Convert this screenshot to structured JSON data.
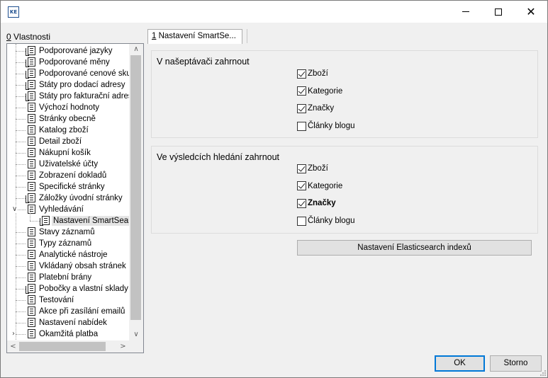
{
  "window": {
    "app_icon_text": "KE",
    "minimize_icon": "minimize-icon",
    "maximize_icon": "maximize-icon",
    "close_icon": "close-icon",
    "close_glyph": "✕"
  },
  "left_panel": {
    "label_key": "0",
    "label_rest": " Vlastnosti"
  },
  "tree": {
    "items": [
      {
        "label": "Podporované jazyky",
        "icon": "multi-doc-icon",
        "level": 1
      },
      {
        "label": "Podporované měny",
        "icon": "multi-doc-icon",
        "level": 1
      },
      {
        "label": "Podporované cenové skupiny",
        "icon": "multi-doc-icon",
        "level": 1
      },
      {
        "label": "Státy pro dodací adresy",
        "icon": "multi-doc-icon",
        "level": 1
      },
      {
        "label": "Státy pro fakturační adresy",
        "icon": "multi-doc-icon",
        "level": 1
      },
      {
        "label": "Výchozí hodnoty",
        "icon": "doc-icon",
        "level": 1
      },
      {
        "label": "Stránky obecně",
        "icon": "doc-icon",
        "level": 1
      },
      {
        "label": "Katalog zboží",
        "icon": "doc-icon",
        "level": 1
      },
      {
        "label": "Detail zboží",
        "icon": "doc-icon",
        "level": 1
      },
      {
        "label": "Nákupní košík",
        "icon": "doc-icon",
        "level": 1
      },
      {
        "label": "Uživatelské účty",
        "icon": "doc-icon",
        "level": 1
      },
      {
        "label": "Zobrazení dokladů",
        "icon": "doc-icon",
        "level": 1
      },
      {
        "label": "Specifické stránky",
        "icon": "doc-icon",
        "level": 1
      },
      {
        "label": "Záložky úvodní stránky",
        "icon": "multi-doc-icon",
        "level": 1
      },
      {
        "label": "Vyhledávání",
        "icon": "doc-icon",
        "level": 1,
        "expanded": true
      },
      {
        "label": "Nastavení SmartSearch",
        "icon": "multi-doc-icon",
        "level": 2,
        "selected": true
      },
      {
        "label": "Stavy záznamů",
        "icon": "doc-icon",
        "level": 1
      },
      {
        "label": "Typy záznamů",
        "icon": "doc-icon",
        "level": 1
      },
      {
        "label": "Analytické nástroje",
        "icon": "doc-icon",
        "level": 1
      },
      {
        "label": "Vkládaný obsah stránek",
        "icon": "doc-icon",
        "level": 1
      },
      {
        "label": "Platební brány",
        "icon": "doc-icon",
        "level": 1
      },
      {
        "label": "Pobočky a vlastní sklady",
        "icon": "multi-doc-icon",
        "level": 1
      },
      {
        "label": "Testování",
        "icon": "doc-icon",
        "level": 1
      },
      {
        "label": "Akce při zasílání emailů",
        "icon": "doc-icon",
        "level": 1
      },
      {
        "label": "Nastavení nabídek",
        "icon": "doc-icon",
        "level": 1
      },
      {
        "label": "Okamžitá platba",
        "icon": "doc-icon",
        "level": 1,
        "collapsed": true
      }
    ],
    "expand_glyph": "∨",
    "collapse_glyph": "›",
    "scroll_up": "∧",
    "scroll_down": "∨",
    "scroll_left": "<",
    "scroll_right": ">"
  },
  "tab": {
    "key": "1",
    "label_rest": " Nastavení SmartSe..."
  },
  "group1": {
    "title": "V našeptávači zahrnout",
    "options": [
      {
        "label": "Zboží",
        "checked": true,
        "bold": false
      },
      {
        "label": "Kategorie",
        "checked": true,
        "bold": false
      },
      {
        "label": "Značky",
        "checked": true,
        "bold": false
      },
      {
        "label": "Články blogu",
        "checked": false,
        "bold": false
      }
    ]
  },
  "group2": {
    "title": "Ve výsledcích hledání zahrnout",
    "options": [
      {
        "label": "Zboží",
        "checked": true,
        "bold": false
      },
      {
        "label": "Kategorie",
        "checked": true,
        "bold": false
      },
      {
        "label": "Značky",
        "checked": true,
        "bold": true
      },
      {
        "label": "Články blogu",
        "checked": false,
        "bold": false
      }
    ]
  },
  "buttons": {
    "elasticsearch": "Nastavení Elasticsearch indexů",
    "ok": "OK",
    "cancel": "Storno"
  }
}
